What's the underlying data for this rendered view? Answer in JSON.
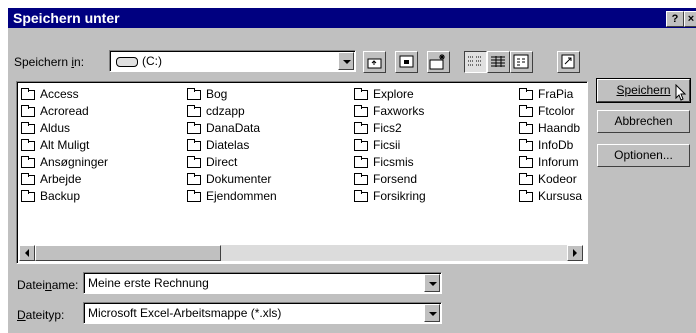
{
  "dialog": {
    "title": "Speichern unter",
    "help_btn": "?",
    "close_btn": "×"
  },
  "location": {
    "label": "Speichern in:",
    "value": "(C:)"
  },
  "toolbar": {
    "icons": [
      "up-one-level-icon",
      "desktop-icon",
      "new-folder-icon",
      "list-view-icon",
      "details-view-icon",
      "properties-icon",
      "commands-icon"
    ]
  },
  "files": {
    "columns": [
      [
        "Access",
        "Acroread",
        "Aldus",
        "Alt Muligt",
        "Ansøgninger",
        "Arbejde",
        "Backup"
      ],
      [
        "Bog",
        "cdzapp",
        "DanaData",
        "Diatelas",
        "Direct",
        "Dokumenter",
        "Ejendommen"
      ],
      [
        "Explore",
        "Faxworks",
        "Fics2",
        "Ficsii",
        "Ficsmis",
        "Forsend",
        "Forsikring"
      ],
      [
        "FraPia",
        "Ftcolor",
        "Haandb",
        "InfoDb",
        "Inforum",
        "Kodeor",
        "Kursusa"
      ]
    ]
  },
  "filename": {
    "label": "Dateiname:",
    "value": "Meine erste Rechnung"
  },
  "filetype": {
    "label": "Dateityp:",
    "value": "Microsoft Excel-Arbeitsmappe (*.xls)"
  },
  "buttons": {
    "save": "Speichern",
    "cancel": "Abbrechen",
    "options": "Optionen..."
  }
}
